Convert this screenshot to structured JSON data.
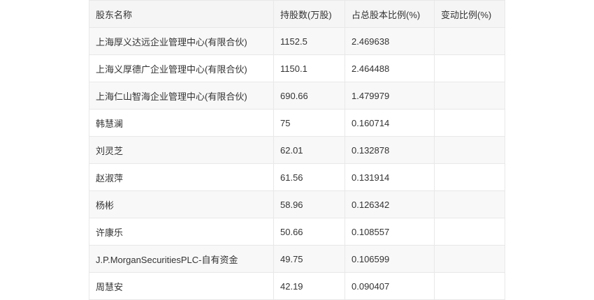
{
  "table": {
    "headers": [
      "股东名称",
      "持股数(万股)",
      "占总股本比例(%)",
      "变动比例(%)"
    ],
    "rows": [
      [
        "上海厚义达远企业管理中心(有限合伙)",
        "1152.5",
        "2.469638",
        ""
      ],
      [
        "上海义厚德广企业管理中心(有限合伙)",
        "1150.1",
        "2.464488",
        ""
      ],
      [
        "上海仁山智海企业管理中心(有限合伙)",
        "690.66",
        "1.479979",
        ""
      ],
      [
        "韩慧澜",
        "75",
        "0.160714",
        ""
      ],
      [
        "刘灵芝",
        "62.01",
        "0.132878",
        ""
      ],
      [
        "赵淑萍",
        "61.56",
        "0.131914",
        ""
      ],
      [
        "杨彬",
        "58.96",
        "0.126342",
        ""
      ],
      [
        "许康乐",
        "50.66",
        "0.108557",
        ""
      ],
      [
        "J.P.MorganSecuritiesPLC-自有资金",
        "49.75",
        "0.106599",
        ""
      ],
      [
        "周慧安",
        "42.19",
        "0.090407",
        ""
      ]
    ]
  }
}
